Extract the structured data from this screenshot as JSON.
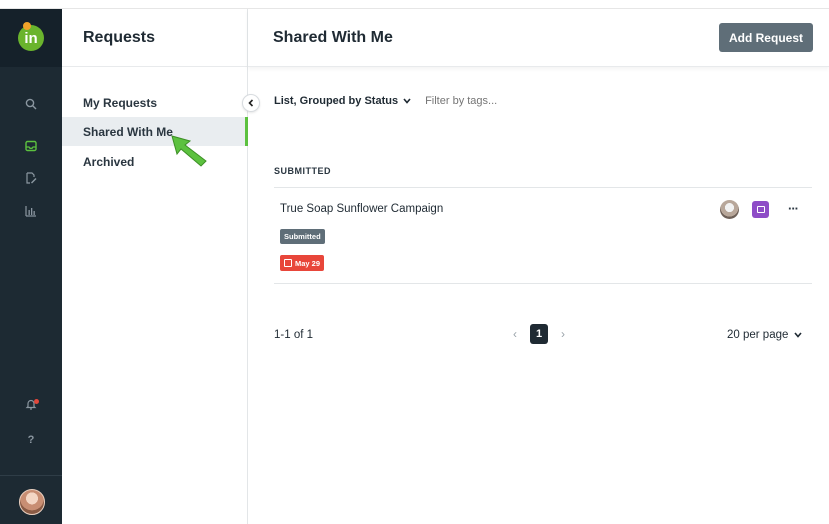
{
  "app": {
    "logo_text": "in",
    "brand_color": "#6ab42d",
    "rail_icons": [
      "search-icon",
      "inbox-icon",
      "edit-file-icon",
      "chart-icon",
      "bell-icon",
      "help-icon"
    ],
    "help_glyph": "?"
  },
  "sidebar": {
    "title": "Requests",
    "items": [
      {
        "label": "My Requests",
        "active": false
      },
      {
        "label": "Shared With Me",
        "active": true
      },
      {
        "label": "Archived",
        "active": false
      }
    ]
  },
  "header": {
    "title": "Shared With Me",
    "add_button": "Add Request"
  },
  "toolbar": {
    "view_label": "List, Grouped by Status",
    "filter_placeholder": "Filter by tags..."
  },
  "groups": [
    {
      "label": "SUBMITTED",
      "items": [
        {
          "title": "True Soap Sunflower Campaign",
          "status": "Submitted",
          "due": "May 29",
          "more": "···"
        }
      ]
    }
  ],
  "pagination": {
    "range": "1-1 of 1",
    "current_page": "1",
    "prev": "‹",
    "next": "›",
    "per_page": "20 per page"
  },
  "colors": {
    "rail_bg": "#1d2a33",
    "active_accent": "#5cc13f",
    "status_badge": "#5f6e78",
    "due_badge": "#e8463a",
    "inbox_badge": "#8e4cc7"
  }
}
